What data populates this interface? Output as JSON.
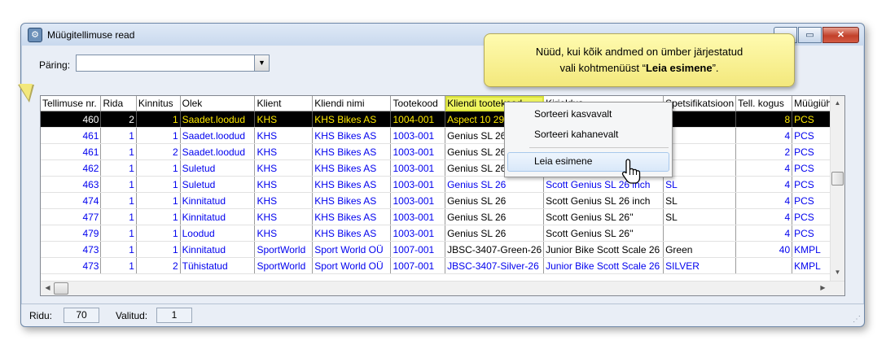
{
  "window": {
    "title": "Müügitellimuse read"
  },
  "query": {
    "label": "Päring:",
    "value": ""
  },
  "grid": {
    "columns": [
      {
        "label": "Tellimuse nr.",
        "w": 71
      },
      {
        "label": "Rida",
        "w": 46
      },
      {
        "label": "Kinnitus",
        "w": 52
      },
      {
        "label": "Olek",
        "w": 92
      },
      {
        "label": "Klient",
        "w": 69
      },
      {
        "label": "Kliendi nimi",
        "w": 95
      },
      {
        "label": "Tootekood",
        "w": 65
      },
      {
        "label": "Kliendi tootekood",
        "w": 116
      },
      {
        "label": "Kirjeldus",
        "w": 143
      },
      {
        "label": "Spetsifikatsioon",
        "w": 81
      },
      {
        "label": "Tell. kogus",
        "w": 68
      },
      {
        "label": "Müügiühik",
        "w": 61
      }
    ],
    "rows": [
      {
        "style": "sel",
        "cells": [
          "460",
          "2",
          "1",
          "Saadet.loodud",
          "KHS",
          "KHS Bikes AS",
          "1004-001",
          "Aspect 10 29",
          "",
          "",
          "8",
          "PCS"
        ]
      },
      {
        "style": "blue",
        "cells": [
          "461",
          "1",
          "1",
          "Saadet.loodud",
          "KHS",
          "KHS Bikes AS",
          "1003-001",
          "Genius SL 26",
          "",
          "",
          "4",
          "PCS"
        ]
      },
      {
        "style": "blue",
        "cells": [
          "461",
          "1",
          "2",
          "Saadet.loodud",
          "KHS",
          "KHS Bikes AS",
          "1003-001",
          "Genius SL 26",
          "",
          "",
          "2",
          "PCS"
        ]
      },
      {
        "style": "blue",
        "cells": [
          "462",
          "1",
          "1",
          "Suletud",
          "KHS",
          "KHS Bikes AS",
          "1003-001",
          "Genius SL 26",
          "",
          "",
          "4",
          "PCS"
        ]
      },
      {
        "style": "blue",
        "cells": [
          "463",
          "1",
          "1",
          "Suletud",
          "KHS",
          "KHS Bikes AS",
          "1003-001",
          "Genius SL 26",
          "Scott Genius SL 26 inch",
          "SL",
          "4",
          "PCS"
        ]
      },
      {
        "style": "mix",
        "cells": [
          "474",
          "1",
          "1",
          "Kinnitatud",
          "KHS",
          "KHS Bikes AS",
          "1003-001",
          "Genius SL 26",
          "Scott Genius SL 26 inch",
          "SL",
          "4",
          "PCS"
        ]
      },
      {
        "style": "mix",
        "cells": [
          "477",
          "1",
          "1",
          "Kinnitatud",
          "KHS",
          "KHS Bikes AS",
          "1003-001",
          "Genius SL 26",
          "Scott Genius SL 26''",
          "SL",
          "4",
          "PCS"
        ]
      },
      {
        "style": "mix",
        "cells": [
          "479",
          "1",
          "1",
          "Loodud",
          "KHS",
          "KHS Bikes AS",
          "1003-001",
          "Genius SL 26",
          "Scott Genius SL 26''",
          "",
          "4",
          "PCS"
        ]
      },
      {
        "style": "mix",
        "cells": [
          "473",
          "1",
          "1",
          "Kinnitatud",
          "SportWorld",
          "Sport World OÜ",
          "1007-001",
          "JBSC-3407-Green-26",
          "Junior Bike Scott Scale 26",
          "Green",
          "40",
          "KMPL"
        ]
      },
      {
        "style": "blue",
        "cells": [
          "473",
          "1",
          "2",
          "Tühistatud",
          "SportWorld",
          "Sport World OÜ",
          "1007-001",
          "JBSC-3407-Silver-26",
          "Junior Bike Scott Scale 26",
          "SILVER",
          "",
          "KMPL"
        ]
      }
    ]
  },
  "context_menu": {
    "items": [
      "Sorteeri kasvavalt",
      "Sorteeri kahanevalt",
      "Leia esimene"
    ]
  },
  "callout": {
    "line1": "Nüüd, kui kõik andmed on ümber järjestatud",
    "line2_pre": "vali kohtmenüüst  “",
    "line2_bold": "Leia esimene",
    "line2_post": "”."
  },
  "status": {
    "rows_label": "Ridu:",
    "rows_value": "70",
    "selected_label": "Valitud:",
    "selected_value": "1"
  }
}
